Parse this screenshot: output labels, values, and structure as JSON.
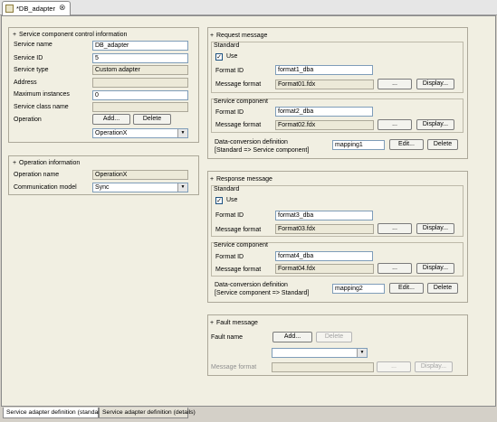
{
  "editor": {
    "tab_title": "*DB_adapter",
    "close_glyph": "⊗"
  },
  "left": {
    "control_info": {
      "header": "Service component control information",
      "service_name_label": "Service name",
      "service_name_value": "DB_adapter",
      "service_id_label": "Service ID",
      "service_id_value": "5",
      "service_type_label": "Service type",
      "service_type_value": "Custom adapter",
      "address_label": "Address",
      "address_value": "",
      "max_instances_label": "Maximum instances",
      "max_instances_value": "0",
      "class_name_label": "Service class name",
      "class_name_value": "",
      "operation_label": "Operation",
      "add_label": "Add...",
      "delete_label": "Delete",
      "operation_selected": "OperationX"
    },
    "operation_info": {
      "header": "Operation information",
      "operation_name_label": "Operation name",
      "operation_name_value": "OperationX",
      "comm_model_label": "Communication model",
      "comm_model_value": "Sync"
    }
  },
  "request": {
    "header": "Request message",
    "standard": {
      "title": "Standard",
      "use_label": "Use",
      "use_checked": true,
      "format_id_label": "Format ID",
      "format_id_value": "format1_dba",
      "msg_format_label": "Message format",
      "msg_format_value": "Format01.fdx",
      "browse_label": "...",
      "display_label": "Display..."
    },
    "service_component": {
      "title": "Service component",
      "format_id_label": "Format ID",
      "format_id_value": "format2_dba",
      "msg_format_label": "Message format",
      "msg_format_value": "Format02.fdx",
      "browse_label": "...",
      "display_label": "Display..."
    },
    "conversion": {
      "label_line1": "Data-conversion definition",
      "label_line2": "[Standard => Service component]",
      "value": "mapping1",
      "edit_label": "Edit...",
      "delete_label": "Delete"
    }
  },
  "response": {
    "header": "Response message",
    "standard": {
      "title": "Standard",
      "use_label": "Use",
      "use_checked": true,
      "format_id_label": "Format ID",
      "format_id_value": "format3_dba",
      "msg_format_label": "Message format",
      "msg_format_value": "Format03.fdx",
      "browse_label": "...",
      "display_label": "Display..."
    },
    "service_component": {
      "title": "Service component",
      "format_id_label": "Format ID",
      "format_id_value": "format4_dba",
      "msg_format_label": "Message format",
      "msg_format_value": "Format04.fdx",
      "browse_label": "...",
      "display_label": "Display..."
    },
    "conversion": {
      "label_line1": "Data-conversion definition",
      "label_line2": "[Service component => Standard]",
      "value": "mapping2",
      "edit_label": "Edit...",
      "delete_label": "Delete"
    }
  },
  "fault": {
    "header": "Fault message",
    "fault_name_label": "Fault name",
    "add_label": "Add...",
    "delete_label": "Delete",
    "selected": "",
    "msg_format_label": "Message format",
    "msg_format_value": "",
    "browse_label": "...",
    "display_label": "Display..."
  },
  "bottom_tabs": [
    {
      "label": "Service adapter definition (standard)",
      "active": true
    },
    {
      "label": "Service adapter definition (details)",
      "active": false
    }
  ]
}
